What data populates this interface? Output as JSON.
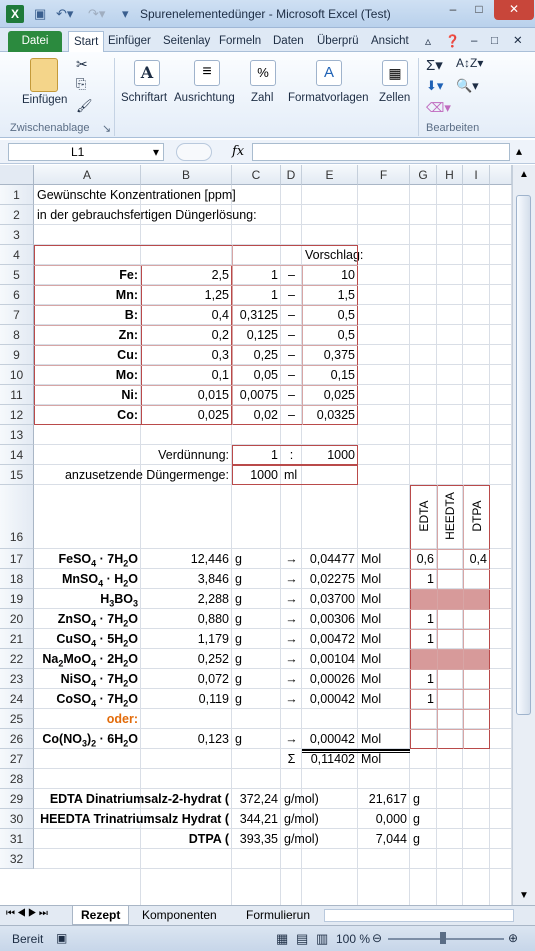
{
  "window": {
    "title": "Spurenelementedünger  -  Microsoft Excel (Test)",
    "app_icon": "X",
    "minimize": "–",
    "maximize": "□",
    "close": "✕"
  },
  "ribbon_tabs": [
    "Datei",
    "Start",
    "Einfüger",
    "Seitenlay",
    "Formeln",
    "Daten",
    "Überprü",
    "Ansicht"
  ],
  "ribbon": {
    "einfuegen": "Einfügen",
    "zwischenablage": "Zwischenablage",
    "schriftart": "Schriftart",
    "ausrichtung": "Ausrichtung",
    "zahl": "Zahl",
    "formatvorlagen": "Formatvorlagen",
    "zellen": "Zellen",
    "bearbeiten": "Bearbeiten"
  },
  "formula_bar": {
    "namebox": "L1",
    "fx": "fx",
    "value": ""
  },
  "columns": [
    "A",
    "B",
    "C",
    "D",
    "E",
    "F",
    "G",
    "H",
    "I"
  ],
  "rows": [
    "1",
    "2",
    "3",
    "4",
    "5",
    "6",
    "7",
    "8",
    "9",
    "10",
    "11",
    "12",
    "13",
    "14",
    "15",
    "16",
    "17",
    "18",
    "19",
    "20",
    "21",
    "22",
    "23",
    "24",
    "25",
    "26",
    "27",
    "28",
    "29",
    "30",
    "31",
    "32"
  ],
  "sheet": {
    "r1": "Gewünschte Konzentrationen [ppm]",
    "r2": "in der gebrauchsfertigen Düngerlösung:",
    "vorschlag": "Vorschlag:",
    "elements": [
      {
        "name": "Fe:",
        "b": "2,5",
        "c": "1",
        "d": "–",
        "e": "10"
      },
      {
        "name": "Mn:",
        "b": "1,25",
        "c": "1",
        "d": "–",
        "e": "1,5"
      },
      {
        "name": "B:",
        "b": "0,4",
        "c": "0,3125",
        "d": "–",
        "e": "0,5"
      },
      {
        "name": "Zn:",
        "b": "0,2",
        "c": "0,125",
        "d": "–",
        "e": "0,5"
      },
      {
        "name": "Cu:",
        "b": "0,3",
        "c": "0,25",
        "d": "–",
        "e": "0,375"
      },
      {
        "name": "Mo:",
        "b": "0,1",
        "c": "0,05",
        "d": "–",
        "e": "0,15"
      },
      {
        "name": "Ni:",
        "b": "0,015",
        "c": "0,0075",
        "d": "–",
        "e": "0,025"
      },
      {
        "name": "Co:",
        "b": "0,025",
        "c": "0,02",
        "d": "–",
        "e": "0,0325"
      }
    ],
    "verduennung_label": "Verdünnung:",
    "verduennung_c": "1",
    "verduennung_d": ":",
    "verduennung_e": "1000",
    "menge_label": "anzusetzende Düngermenge:",
    "menge_value": "1000",
    "menge_unit": "ml",
    "chelators": [
      "EDTA",
      "HEEDTA",
      "DTPA"
    ],
    "salts": [
      {
        "formula_html": "FeSO<sub>4</sub> · 7H<sub>2</sub>O",
        "b": "12,446",
        "c": "g",
        "arrow": "→",
        "e": "0,04477",
        "f": "Mol",
        "g": "0,6",
        "h": "",
        "i": "0,4"
      },
      {
        "formula_html": "MnSO<sub>4</sub> · H<sub>2</sub>O",
        "b": "3,846",
        "c": "g",
        "arrow": "→",
        "e": "0,02275",
        "f": "Mol",
        "g": "1",
        "h": "",
        "i": ""
      },
      {
        "formula_html": "H<sub>3</sub>BO<sub>3</sub>",
        "b": "2,288",
        "c": "g",
        "arrow": "→",
        "e": "0,03700",
        "f": "Mol",
        "g": "",
        "h": "",
        "i": ""
      },
      {
        "formula_html": "ZnSO<sub>4</sub> · 7H<sub>2</sub>O",
        "b": "0,880",
        "c": "g",
        "arrow": "→",
        "e": "0,00306",
        "f": "Mol",
        "g": "1",
        "h": "",
        "i": ""
      },
      {
        "formula_html": "CuSO<sub>4</sub> · 5H<sub>2</sub>O",
        "b": "1,179",
        "c": "g",
        "arrow": "→",
        "e": "0,00472",
        "f": "Mol",
        "g": "1",
        "h": "",
        "i": ""
      },
      {
        "formula_html": "Na<sub>2</sub>MoO<sub>4</sub> · 2H<sub>2</sub>O",
        "b": "0,252",
        "c": "g",
        "arrow": "→",
        "e": "0,00104",
        "f": "Mol",
        "g": "",
        "h": "",
        "i": ""
      },
      {
        "formula_html": "NiSO<sub>4</sub> · 7H<sub>2</sub>O",
        "b": "0,072",
        "c": "g",
        "arrow": "→",
        "e": "0,00026",
        "f": "Mol",
        "g": "1",
        "h": "",
        "i": ""
      },
      {
        "formula_html": "CoSO<sub>4</sub> · 7H<sub>2</sub>O",
        "b": "0,119",
        "c": "g",
        "arrow": "→",
        "e": "0,00042",
        "f": "Mol",
        "g": "1",
        "h": "",
        "i": ""
      }
    ],
    "oder": "oder:",
    "alt_salt": {
      "formula_html": "Co(NO<sub>3</sub>)<sub>2</sub> · 6H<sub>2</sub>O",
      "b": "0,123",
      "c": "g",
      "arrow": "→",
      "e": "0,00042",
      "f": "Mol"
    },
    "sum_symbol": "Σ",
    "sum_value": "0,11402",
    "sum_unit": "Mol",
    "chelator_salts": [
      {
        "name": "EDTA Dinatriumsalz-2-hydrat (",
        "b": "372,24",
        "c": "g/mol)",
        "e": "21,617",
        "f": "g"
      },
      {
        "name": "HEEDTA Trinatriumsalz Hydrat (",
        "b": "344,21",
        "c": "g/mol)",
        "e": "0,000",
        "f": "g"
      },
      {
        "name": "DTPA (",
        "b": "393,35",
        "c": "g/mol)",
        "e": "7,044",
        "f": "g"
      }
    ]
  },
  "sheet_tabs": [
    "Rezept",
    "Komponenten",
    "Formulierun"
  ],
  "status": {
    "ready": "Bereit",
    "zoom": "100 %"
  },
  "colors": {
    "accent_green": "#2b8a3e",
    "red_border": "#b94a4a",
    "pink_fill": "#d79a9a"
  }
}
